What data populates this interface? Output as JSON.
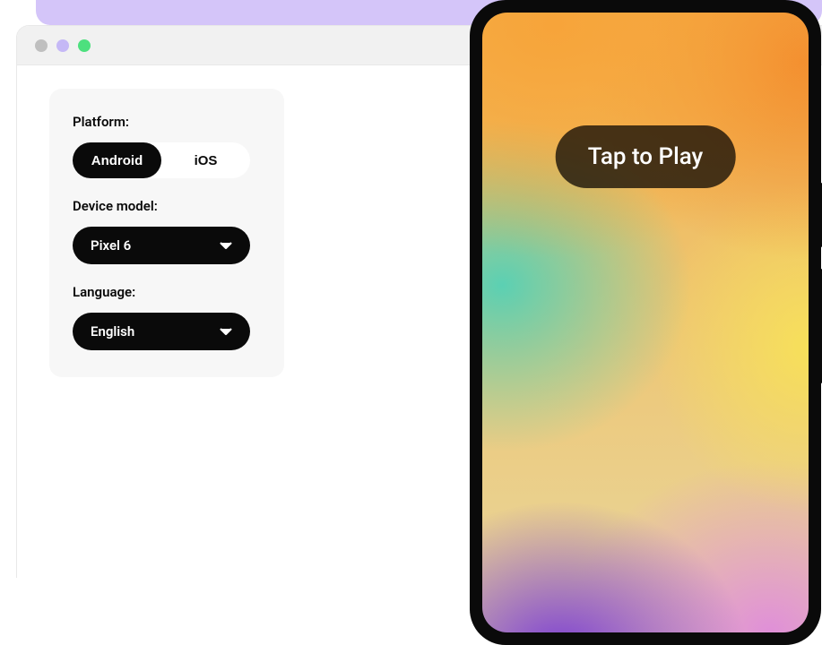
{
  "controls": {
    "platform": {
      "label": "Platform:",
      "options": {
        "android": "Android",
        "ios": "iOS"
      },
      "selected": "android"
    },
    "device_model": {
      "label": "Device model:",
      "value": "Pixel 6"
    },
    "language": {
      "label": "Language:",
      "value": "English"
    }
  },
  "phone": {
    "tap_to_play": "Tap to Play"
  }
}
